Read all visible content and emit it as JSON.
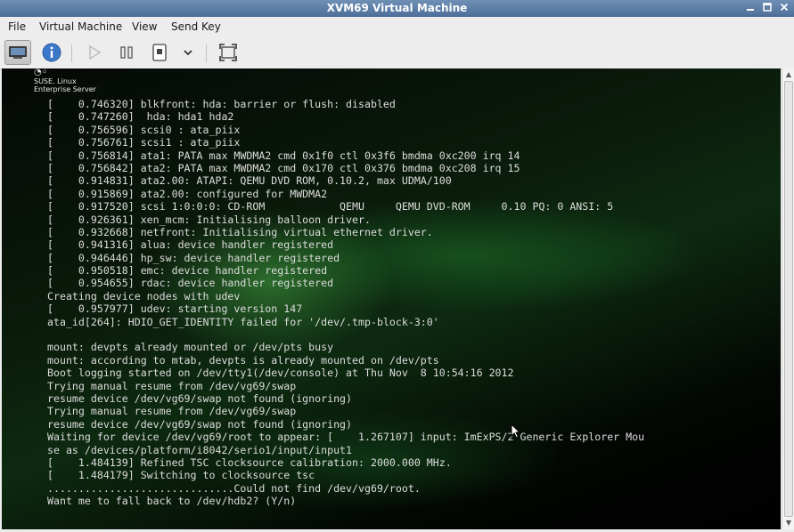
{
  "window": {
    "title": "XVM69 Virtual Machine",
    "controls": [
      "minimize-icon",
      "maximize-icon",
      "close-icon"
    ]
  },
  "menubar": {
    "items": [
      "File",
      "Virtual Machine",
      "View",
      "Send Key"
    ]
  },
  "toolbar": {
    "buttons": [
      "console-view-icon",
      "details-info-icon",
      "run-icon",
      "pause-icon",
      "shutdown-icon",
      "shutdown-menu-chevron-icon",
      "fullscreen-icon"
    ],
    "accent": "#3b78c9"
  },
  "console": {
    "brand_line1": "SUSE. Linux",
    "brand_line2": "Enterprise Server",
    "lines": [
      "[    0.746320] blkfront: hda: barrier or flush: disabled",
      "[    0.747260]  hda: hda1 hda2",
      "[    0.756596] scsi0 : ata_piix",
      "[    0.756761] scsi1 : ata_piix",
      "[    0.756814] ata1: PATA max MWDMA2 cmd 0x1f0 ctl 0x3f6 bmdma 0xc200 irq 14",
      "[    0.756842] ata2: PATA max MWDMA2 cmd 0x170 ctl 0x376 bmdma 0xc208 irq 15",
      "[    0.914831] ata2.00: ATAPI: QEMU DVD ROM, 0.10.2, max UDMA/100",
      "[    0.915869] ata2.00: configured for MWDMA2",
      "[    0.917520] scsi 1:0:0:0: CD-ROM            QEMU     QEMU DVD-ROM     0.10 PQ: 0 ANSI: 5",
      "[    0.926361] xen_mcm: Initialising balloon driver.",
      "[    0.932668] netfront: Initialising virtual ethernet driver.",
      "[    0.941316] alua: device handler registered",
      "[    0.946446] hp_sw: device handler registered",
      "[    0.950518] emc: device handler registered",
      "[    0.954655] rdac: device handler registered",
      "Creating device nodes with udev",
      "[    0.957977] udev: starting version 147",
      "ata_id[264]: HDIO_GET_IDENTITY failed for '/dev/.tmp-block-3:0'",
      "",
      "mount: devpts already mounted or /dev/pts busy",
      "mount: according to mtab, devpts is already mounted on /dev/pts",
      "Boot logging started on /dev/tty1(/dev/console) at Thu Nov  8 10:54:16 2012",
      "Trying manual resume from /dev/vg69/swap",
      "resume device /dev/vg69/swap not found (ignoring)",
      "Trying manual resume from /dev/vg69/swap",
      "resume device /dev/vg69/swap not found (ignoring)",
      "Waiting for device /dev/vg69/root to appear: [    1.267107] input: ImExPS/2 Generic Explorer Mou",
      "se as /devices/platform/i8042/serio1/input/input1",
      "[    1.484139] Refined TSC clocksource calibration: 2000.000 MHz.",
      "[    1.484179] Switching to clocksource tsc",
      "..............................Could not find /dev/vg69/root.",
      "Want me to fall back to /dev/hdb2? (Y/n)"
    ]
  }
}
